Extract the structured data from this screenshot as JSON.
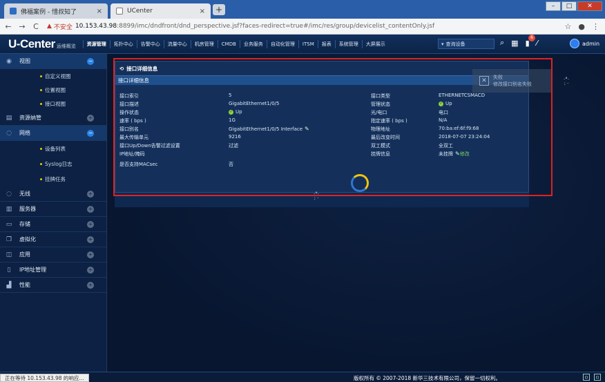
{
  "browser": {
    "tabs": [
      {
        "title": "佛福案例 - 惜叔知了",
        "close": "×"
      },
      {
        "title": "UCenter",
        "close": "×"
      }
    ],
    "new_tab": "+",
    "security_label": "不安全",
    "url_host": "10.153.43.98",
    "url_path": ":8899/imc/dndfront/dnd_perspective.jsf?faces-redirect=true#/imc/res/group/devicelist_contentOnly.jsf",
    "status_text": "正在等待 10.153.43.98 的响应..."
  },
  "header": {
    "logo": "U-Center",
    "logo_sub": "运维概览",
    "nav": [
      "资源管理",
      "拓扑中心",
      "告警中心",
      "流量中心",
      "机房管理",
      "CMDB",
      "业务服务",
      "自动化管理",
      "ITSM",
      "报表",
      "系统管理",
      "大屏展示"
    ],
    "search_placeholder": "查询设备",
    "notification_count": "6",
    "user": "admin"
  },
  "sidebar": {
    "items": [
      {
        "label": "视图",
        "icon": "eye-icon",
        "open": true,
        "subs": [
          "自定义视图",
          "位置视图",
          "接口视图"
        ]
      },
      {
        "label": "资源纳管",
        "icon": "calendar-icon",
        "open": false,
        "subs": []
      },
      {
        "label": "网络",
        "icon": "network-icon",
        "open": true,
        "subs": [
          "设备列表",
          "Syslog日志",
          "挂牌任务"
        ]
      },
      {
        "label": "无线",
        "icon": "wireless-icon",
        "open": false,
        "subs": []
      },
      {
        "label": "服务器",
        "icon": "server-icon",
        "open": false,
        "subs": []
      },
      {
        "label": "存储",
        "icon": "storage-icon",
        "open": false,
        "subs": []
      },
      {
        "label": "虚拟化",
        "icon": "virtual-icon",
        "open": false,
        "subs": []
      },
      {
        "label": "应用",
        "icon": "app-icon",
        "open": false,
        "subs": []
      },
      {
        "label": "IP地址管理",
        "icon": "ip-icon",
        "open": false,
        "subs": []
      },
      {
        "label": "性能",
        "icon": "performance-icon",
        "open": false,
        "subs": []
      }
    ]
  },
  "panel": {
    "title": "接口详细信息",
    "bar_title": "接口详细信息",
    "left": [
      {
        "k": "接口索引",
        "v": "5"
      },
      {
        "k": "接口描述",
        "v": "GigabitEthernet1/0/5"
      },
      {
        "k": "操作状态",
        "v": "Up"
      },
      {
        "k": "速率 ( bps )",
        "v": "1G"
      },
      {
        "k": "接口别名",
        "v": "GigabitEthernet1/0/5 Interface"
      },
      {
        "k": "最大传输单元",
        "v": "9216"
      },
      {
        "k": "接口Up/Down告警过滤设置",
        "v": "过滤"
      },
      {
        "k": "IP地址/掩码",
        "v": ""
      },
      {
        "k": "是否支持MACsec",
        "v": "否"
      }
    ],
    "right": [
      {
        "k": "接口类型",
        "v": "ETHERNETCSMACD"
      },
      {
        "k": "管理状态",
        "v": "Up"
      },
      {
        "k": "光/电口",
        "v": "电口"
      },
      {
        "k": "指定速率 ( bps )",
        "v": "N/A"
      },
      {
        "k": "物理地址",
        "v": "70:ba:ef:6f:f9:68"
      },
      {
        "k": "最后改变时间",
        "v": "2018-07-07 23:24:04"
      },
      {
        "k": "双工模式",
        "v": "全双工"
      },
      {
        "k": "挂牌信息",
        "v": "未挂牌"
      }
    ],
    "edit_label": "修改"
  },
  "toast": {
    "title": "失败",
    "message": "修改接口别名失败"
  },
  "footer": {
    "copyright": "版权所有 © 2007-2018 新华三技术有限公司，保留一切权利。"
  }
}
